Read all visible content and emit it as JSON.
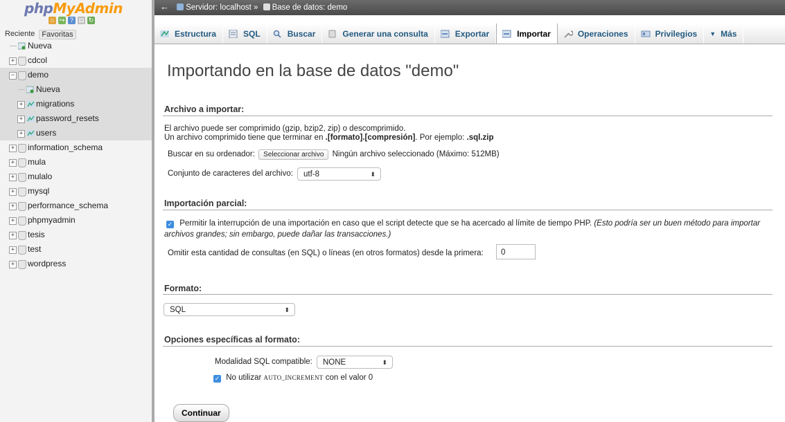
{
  "logo": {
    "part1": "php",
    "part2": "MyAdmin"
  },
  "nav_tabs": {
    "recent": "Reciente",
    "favorites": "Favoritas"
  },
  "tree": [
    {
      "label": "Nueva",
      "level": 0,
      "kind": "new"
    },
    {
      "label": "cdcol",
      "level": 0,
      "kind": "db"
    },
    {
      "label": "demo",
      "level": 0,
      "kind": "db",
      "expanded": true,
      "selected": true
    },
    {
      "label": "Nueva",
      "level": 1,
      "kind": "new"
    },
    {
      "label": "migrations",
      "level": 1,
      "kind": "table"
    },
    {
      "label": "password_resets",
      "level": 1,
      "kind": "table"
    },
    {
      "label": "users",
      "level": 1,
      "kind": "table"
    },
    {
      "label": "information_schema",
      "level": 0,
      "kind": "db"
    },
    {
      "label": "mula",
      "level": 0,
      "kind": "db"
    },
    {
      "label": "mulalo",
      "level": 0,
      "kind": "db"
    },
    {
      "label": "mysql",
      "level": 0,
      "kind": "db"
    },
    {
      "label": "performance_schema",
      "level": 0,
      "kind": "db"
    },
    {
      "label": "phpmyadmin",
      "level": 0,
      "kind": "db"
    },
    {
      "label": "tesis",
      "level": 0,
      "kind": "db"
    },
    {
      "label": "test",
      "level": 0,
      "kind": "db"
    },
    {
      "label": "wordpress",
      "level": 0,
      "kind": "db"
    }
  ],
  "breadcrumb": {
    "server": "Servidor: localhost »",
    "database": "Base de datos: demo"
  },
  "tabs": [
    {
      "label": "Estructura",
      "icon": "structure-icon"
    },
    {
      "label": "SQL",
      "icon": "sql-icon"
    },
    {
      "label": "Buscar",
      "icon": "search-icon"
    },
    {
      "label": "Generar una consulta",
      "icon": "query-icon"
    },
    {
      "label": "Exportar",
      "icon": "export-icon"
    },
    {
      "label": "Importar",
      "icon": "import-icon",
      "active": true
    },
    {
      "label": "Operaciones",
      "icon": "wrench-icon"
    },
    {
      "label": "Privilegios",
      "icon": "privileges-icon"
    },
    {
      "label": "Más",
      "icon": "chevron-down-icon"
    }
  ],
  "page": {
    "title": "Importando en la base de datos \"demo\"",
    "file_section": "Archivo a importar:",
    "file_desc1": "El archivo puede ser comprimido (gzip, bzip2, zip) o descomprimido.",
    "file_desc2_a": "Un archivo comprimido tiene que terminar en ",
    "file_desc2_b": ".[formato].[compresión]",
    "file_desc2_c": ". Por ejemplo: ",
    "file_desc2_d": ".sql.zip",
    "browse_label": "Buscar en su ordenador:",
    "browse_button": "Seleccionar archivo",
    "no_file": "Ningún archivo seleccionado",
    "max_size": "(Máximo: 512MB)",
    "charset_label": "Conjunto de caracteres del archivo:",
    "charset_value": "utf-8",
    "partial_section": "Importación parcial:",
    "allow_interrupt": "Permitir la interrupción de una importación en caso que el script detecte que se ha acercado al límite de tiempo PHP.",
    "allow_interrupt_note": "(Esto podría ser un buen método para importar",
    "allow_interrupt_note2": "archivos grandes; sin embargo, puede dañar las transacciones.)",
    "skip_label": "Omitir esta cantidad de consultas (en SQL) o líneas (en otros formatos) desde la primera:",
    "skip_value": "0",
    "format_section": "Formato:",
    "format_value": "SQL",
    "options_section": "Opciones específicas al formato:",
    "sql_compat_label": "Modalidad SQL compatible:",
    "sql_compat_value": "NONE",
    "no_auto_a": "No utilizar ",
    "no_auto_code": "AUTO_INCREMENT",
    "no_auto_b": " con el valor 0",
    "submit": "Continuar"
  }
}
